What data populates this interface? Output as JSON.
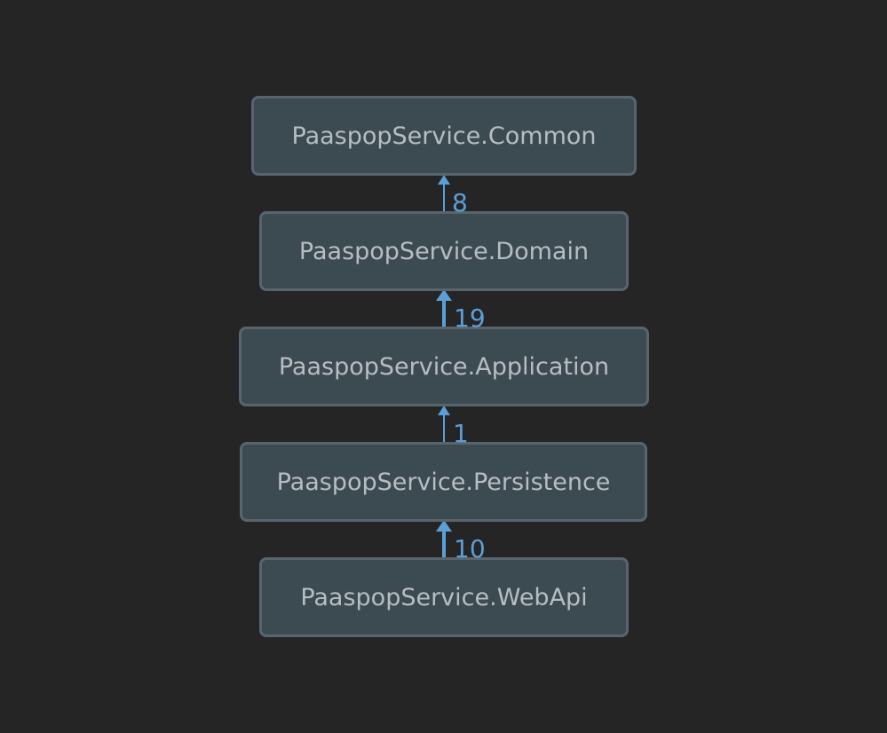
{
  "diagram": {
    "nodes": [
      {
        "id": "common",
        "label": "PaaspopService.Common"
      },
      {
        "id": "domain",
        "label": "PaaspopService.Domain"
      },
      {
        "id": "application",
        "label": "PaaspopService.Application"
      },
      {
        "id": "persistence",
        "label": "PaaspopService.Persistence"
      },
      {
        "id": "webapi",
        "label": "PaaspopService.WebApi"
      }
    ],
    "edges": [
      {
        "from": "domain",
        "to": "common",
        "label": "8"
      },
      {
        "from": "application",
        "to": "domain",
        "label": "19"
      },
      {
        "from": "persistence",
        "to": "application",
        "label": "1"
      },
      {
        "from": "webapi",
        "to": "persistence",
        "label": "10"
      }
    ],
    "colors": {
      "background": "#252525",
      "node_fill": "#3c4a51",
      "node_border": "#59656c",
      "node_text": "#b7bec2",
      "edge": "#5b9fd7"
    }
  }
}
